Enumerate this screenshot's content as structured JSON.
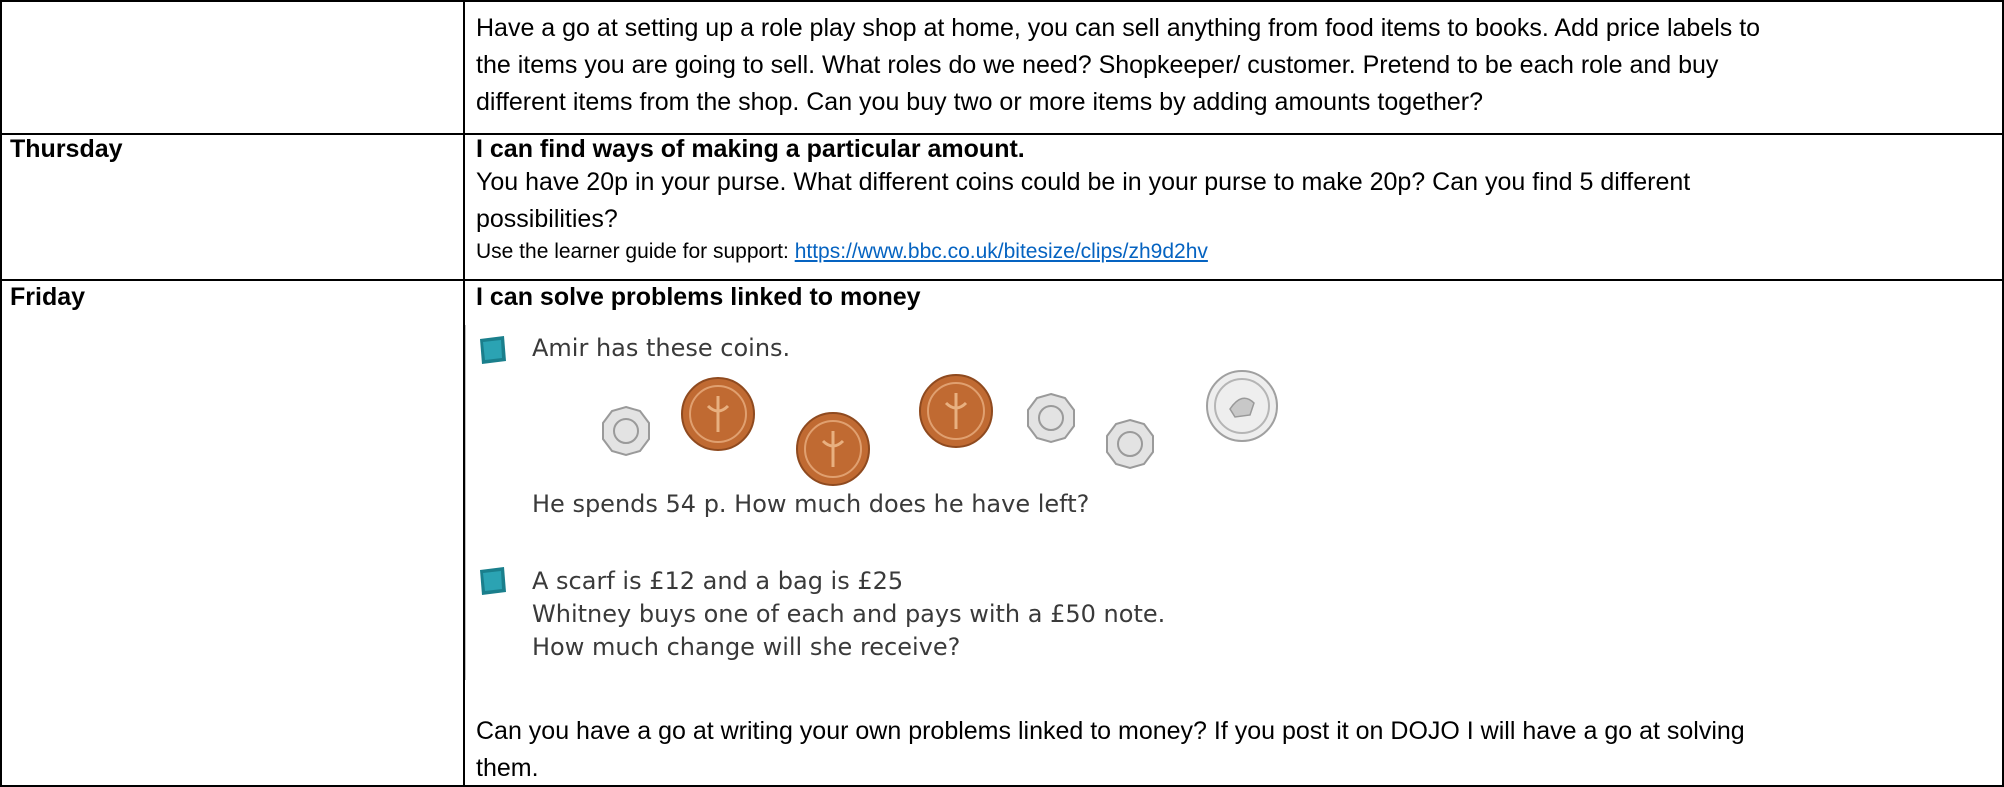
{
  "row_top": {
    "lines": [
      "Have a go at setting up a role play shop at home, you can sell anything from food items to books. Add price labels to",
      "the items you are going to sell. What roles do we need? Shopkeeper/ customer. Pretend to be each role and buy",
      "different items from the shop. Can you buy two or more items by adding amounts together?"
    ]
  },
  "thursday": {
    "day": "Thursday",
    "heading": "I can find ways of making a particular amount.",
    "lines": [
      "You have 20p in your purse. What different coins could be in your purse to make 20p? Can you find 5 different",
      "possibilities?"
    ],
    "support_prefix": "Use the learner guide for support: ",
    "support_link": "https://www.bbc.co.uk/bitesize/clips/zh9d2hv"
  },
  "friday": {
    "day": "Friday",
    "heading": "I can solve problems linked to money",
    "q1_intro": "Amir has these coins.",
    "q1_question": "He spends 54 p. How much does he have left?",
    "q2_lines": [
      "A scarf is £12 and a bag is £25",
      "Whitney buys one of each and pays with a £50 note.",
      "How much change will she receive?"
    ],
    "coins": [
      {
        "name": "20p",
        "label": "20"
      },
      {
        "name": "2p",
        "label": "2"
      },
      {
        "name": "2p",
        "label": "2"
      },
      {
        "name": "2p",
        "label": "2"
      },
      {
        "name": "20p",
        "label": "20"
      },
      {
        "name": "20p",
        "label": "20"
      },
      {
        "name": "10p",
        "label": "10"
      }
    ],
    "closing_lines": [
      "Can you have a go at writing your own problems linked to money? If you post it on DOJO I will have a go at solving",
      "them."
    ]
  },
  "colors": {
    "link": "#0563c1",
    "icon_teal": "#1a7f8c",
    "copper": "#b8652e",
    "silver": "#c9c9c9"
  }
}
